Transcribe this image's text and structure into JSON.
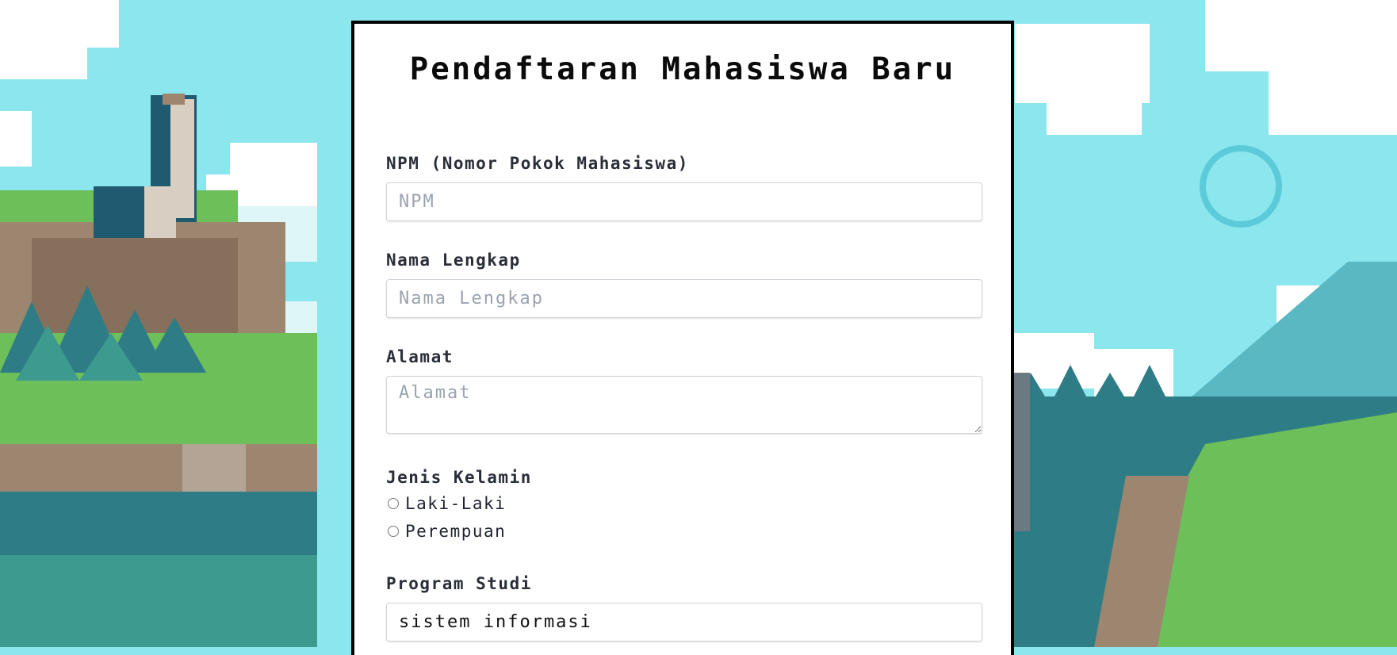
{
  "form": {
    "title": "Pendaftaran Mahasiswa Baru",
    "npm": {
      "label": "NPM (Nomor Pokok Mahasiswa)",
      "placeholder": "NPM"
    },
    "nama": {
      "label": "Nama Lengkap",
      "placeholder": "Nama Lengkap"
    },
    "alamat": {
      "label": "Alamat",
      "placeholder": "Alamat"
    },
    "gender": {
      "label": "Jenis Kelamin",
      "options": [
        "Laki-Laki",
        "Perempuan"
      ]
    },
    "prodi": {
      "label": "Program Studi",
      "value": "sistem informasi"
    }
  },
  "colors": {
    "sky": "#8be6ee",
    "cloud": "#ffffff",
    "grass": "#6cbf59",
    "forest": "#2e7c86",
    "rock": "#9c8670",
    "card_border": "#000000"
  }
}
